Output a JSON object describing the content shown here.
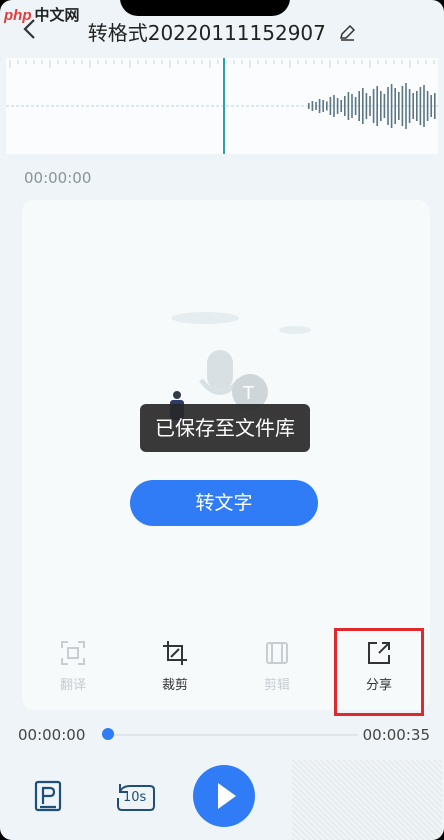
{
  "watermark": {
    "brand": "php",
    "site": "中文网"
  },
  "header": {
    "title": "转格式20220111152907"
  },
  "wave": {
    "playhead": 0.5
  },
  "time_top": "00:00:00",
  "toast": "已保存至文件库",
  "primary_button": "转文字",
  "actions": [
    {
      "label": "翻译"
    },
    {
      "label": "裁剪"
    },
    {
      "label": "剪辑"
    },
    {
      "label": "分享"
    }
  ],
  "progress": {
    "current": "00:00:00",
    "total": "00:00:35",
    "fraction": 0.0
  },
  "controls": {
    "rewind_label": "10s"
  },
  "colors": {
    "accent": "#2f7cf6",
    "highlight": "#e0292b"
  }
}
